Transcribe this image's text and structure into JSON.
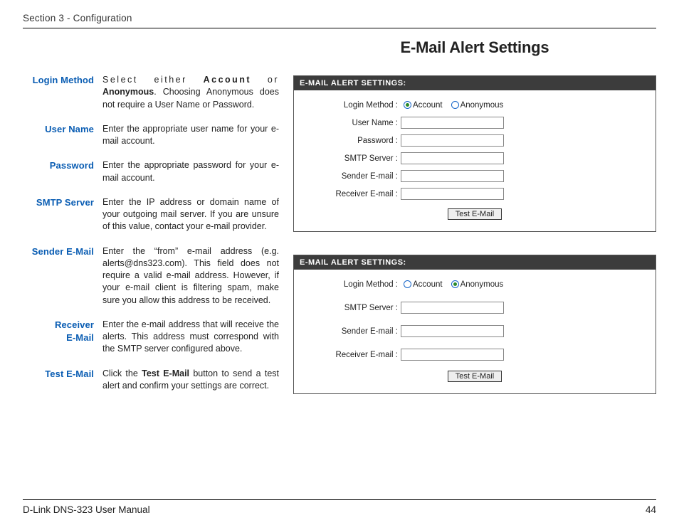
{
  "header": {
    "section": "Section 3 - Configuration"
  },
  "title": "E-Mail Alert Settings",
  "defs": {
    "loginMethod": {
      "label": "Login Method",
      "pre": "Select either ",
      "b1": "Account",
      "mid": " or ",
      "b2": "Anonymous",
      "post": ". Choosing Anonymous does not require a User Name or Password."
    },
    "userName": {
      "label": "User Name",
      "text": "Enter the appropriate user name for your e-mail account."
    },
    "password": {
      "label": "Password",
      "text": "Enter the appropriate password for your e-mail account."
    },
    "smtp": {
      "label": "SMTP Server",
      "text": "Enter the IP address or domain name of your outgoing mail server. If you are unsure of this value, contact your e-mail provider."
    },
    "sender": {
      "label": "Sender E-Mail",
      "text": "Enter the “from” e-mail address (e.g. alerts@dns323.com). This field does not require a valid e-mail address. However, if your e-mail client is filtering spam, make sure you allow this address to be received."
    },
    "receiver": {
      "label1": "Receiver",
      "label2": "E-Mail",
      "text": "Enter the e-mail address that will receive the alerts. This address must correspond with the SMTP server configured above."
    },
    "test": {
      "label": "Test E-Mail",
      "pre": "Click the ",
      "b1": "Test E-Mail",
      "post": " button to send a test alert and confirm your settings are correct."
    }
  },
  "panel1": {
    "header": "E-MAIL ALERT SETTINGS:",
    "labels": {
      "login": "Login Method :",
      "user": "User Name :",
      "pass": "Password :",
      "smtp": "SMTP Server :",
      "sender": "Sender E-mail :",
      "receiver": "Receiver E-mail :"
    },
    "options": {
      "account": "Account",
      "anonymous": "Anonymous"
    },
    "button": "Test E-Mail"
  },
  "panel2": {
    "header": "E-MAIL ALERT SETTINGS:",
    "labels": {
      "login": "Login Method :",
      "smtp": "SMTP Server :",
      "sender": "Sender E-mail :",
      "receiver": "Receiver E-mail :"
    },
    "options": {
      "account": "Account",
      "anonymous": "Anonymous"
    },
    "button": "Test E-Mail"
  },
  "footer": {
    "left": "D-Link DNS-323 User Manual",
    "right": "44"
  }
}
